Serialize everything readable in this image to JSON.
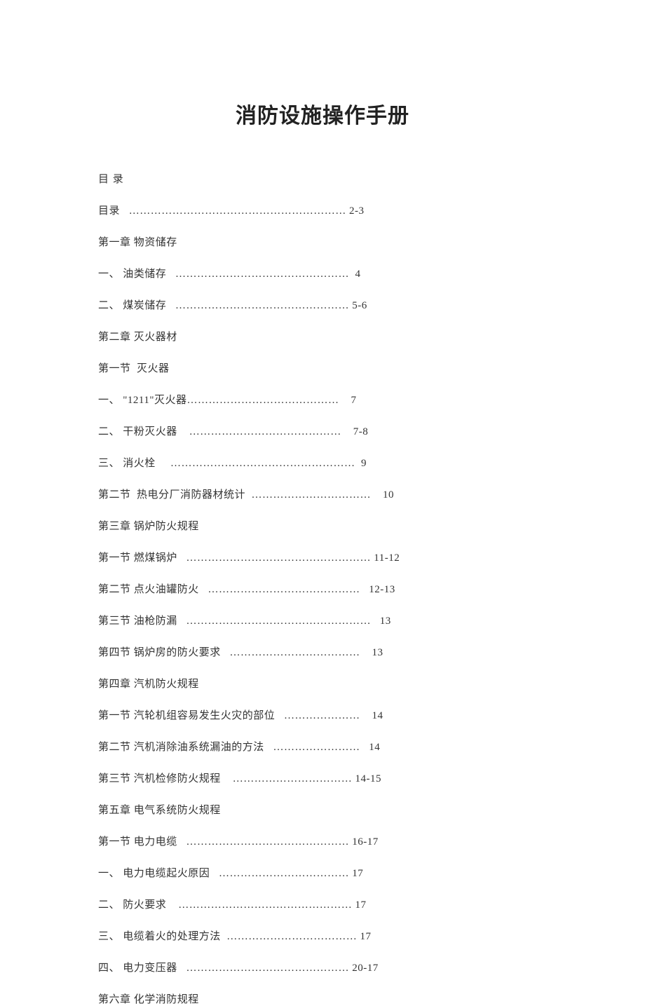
{
  "title": "消防设施操作手册",
  "toc_heading": "目    录",
  "lines": [
    "目录   …………………………………………………… 2-3",
    "第一章 物资储存",
    "一、 油类储存   …………………………………………  4",
    "二、 煤炭储存   ………………………………………… 5-6",
    "第二章 灭火器材",
    "第一节  灭火器",
    "一、 \"1211\"灭火器……………………………………    7",
    "二、 干粉灭火器    ……………………………………    7-8",
    "三、 消火栓     ……………………………………………  9",
    "第二节  热电分厂消防器材统计  ……………………………    10",
    "第三章 锅炉防火规程",
    "第一节 燃煤锅炉   …………………………………………… 11-12",
    "第二节 点火油罐防火   ……………………………………   12-13",
    "第三节 油枪防漏   ……………………………………………   13",
    "第四节 锅炉房的防火要求   ………………………………    13",
    "第四章 汽机防火规程",
    "第一节 汽轮机组容易发生火灾的部位   …………………    14",
    "第二节 汽机消除油系统漏油的方法   ……………………   14",
    "第三节 汽机检修防火规程    …………………………… 14-15",
    "第五章 电气系统防火规程",
    "第一节 电力电缆   ……………………………………… 16-17",
    "一、 电力电缆起火原因   ……………………………… 17",
    "二、 防火要求    ………………………………………… 17",
    "三、 电缆着火的处理方法  ……………………………… 17",
    "四、 电力变压器   ……………………………………… 20-17",
    "第六章 化学消防规程"
  ]
}
